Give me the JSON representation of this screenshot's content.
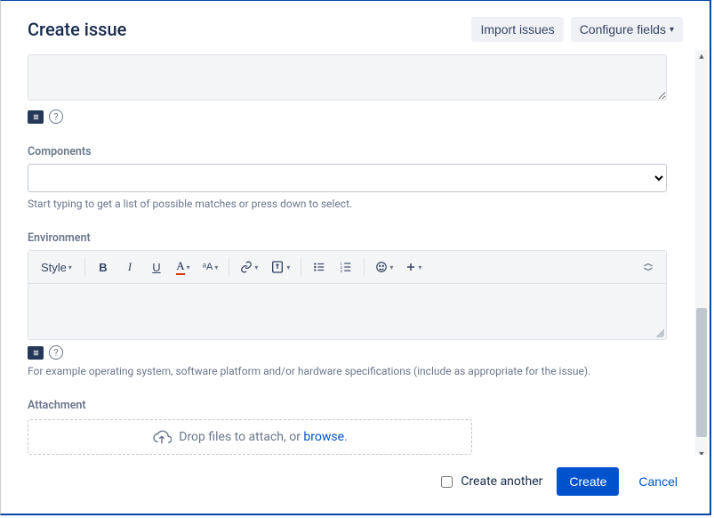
{
  "header": {
    "title": "Create issue",
    "import_label": "Import issues",
    "configure_label": "Configure fields"
  },
  "fields": {
    "components": {
      "label": "Components",
      "help": "Start typing to get a list of possible matches or press down to select."
    },
    "environment": {
      "label": "Environment",
      "help": "For example operating system, software platform and/or hardware specifications (include as appropriate for the issue)."
    },
    "attachment": {
      "label": "Attachment",
      "drop_text": "Drop files to attach, or ",
      "browse": "browse",
      "period": "."
    }
  },
  "rte": {
    "style": "Style"
  },
  "footer": {
    "create_another": "Create another",
    "create": "Create",
    "cancel": "Cancel"
  }
}
